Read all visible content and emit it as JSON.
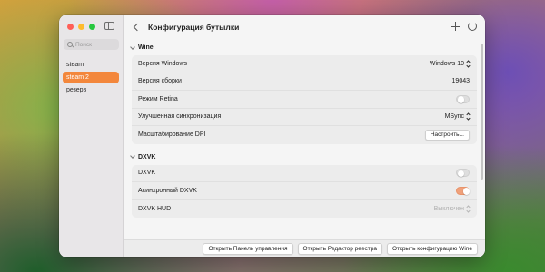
{
  "window": {
    "title": "Конфигурация бутылки"
  },
  "sidebar": {
    "search_placeholder": "Поиск",
    "bottles": [
      {
        "label": "steam",
        "selected": false
      },
      {
        "label": "steam 2",
        "selected": true
      },
      {
        "label": "резерв",
        "selected": false
      }
    ],
    "accent_color": "#f3873c"
  },
  "toolbar": {
    "icons": [
      "chevron-left-icon",
      "plus-icon",
      "refresh-icon"
    ]
  },
  "sections": {
    "wine": {
      "title": "Wine",
      "windows_version_label": "Версия Windows",
      "windows_version_value": "Windows 10",
      "build_label": "Версия сборки",
      "build_value": "19043",
      "retina_label": "Режим Retina",
      "retina_on": false,
      "sync_label": "Улучшенная синхронизация",
      "sync_value": "MSync",
      "dpi_label": "Масштабирование DPI",
      "dpi_button": "Настроить..."
    },
    "dxvk": {
      "title": "DXVK",
      "dxvk_label": "DXVK",
      "dxvk_on": false,
      "async_label": "Асинхронный DXVK",
      "async_on": true,
      "hud_label": "DXVK HUD",
      "hud_value": "Выключен"
    }
  },
  "footer": {
    "control_panel": "Открыть Панель управления",
    "registry_editor": "Открыть Редактор реестра",
    "wine_config": "Открыть конфигурацию Wine"
  }
}
